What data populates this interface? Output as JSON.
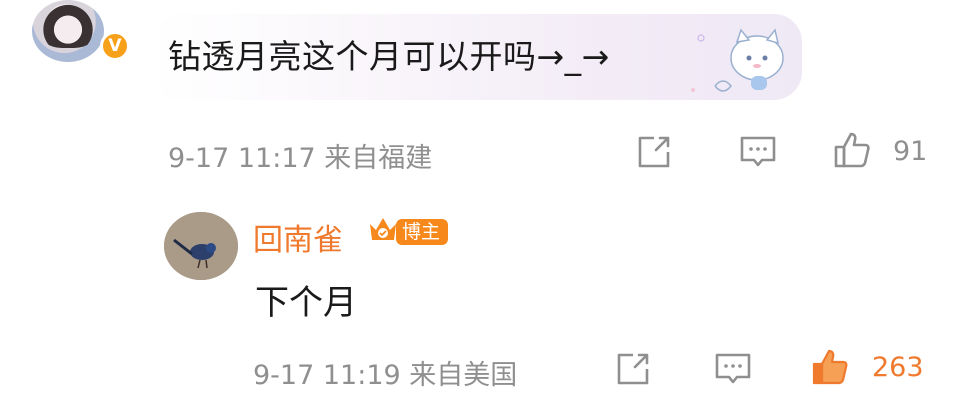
{
  "comment": {
    "badge": "V",
    "text": "钻透月亮这个月可以开吗→_→",
    "time": "9-17 11:17",
    "location": "来自福建",
    "like_count": "91",
    "icons": [
      "share-icon",
      "comment-icon",
      "like-icon"
    ]
  },
  "reply": {
    "username": "回南雀",
    "role_tag": "博主",
    "text": "下个月",
    "time": "9-17 11:19",
    "location": "来自美国",
    "like_count": "263",
    "liked": true,
    "icons": [
      "share-icon",
      "comment-icon",
      "like-icon"
    ]
  },
  "colors": {
    "accent_orange": "#ef7a2d",
    "badge_orange": "#f7a11b",
    "meta_gray": "#8f8f8f",
    "text_dark": "#1a1a1a"
  }
}
